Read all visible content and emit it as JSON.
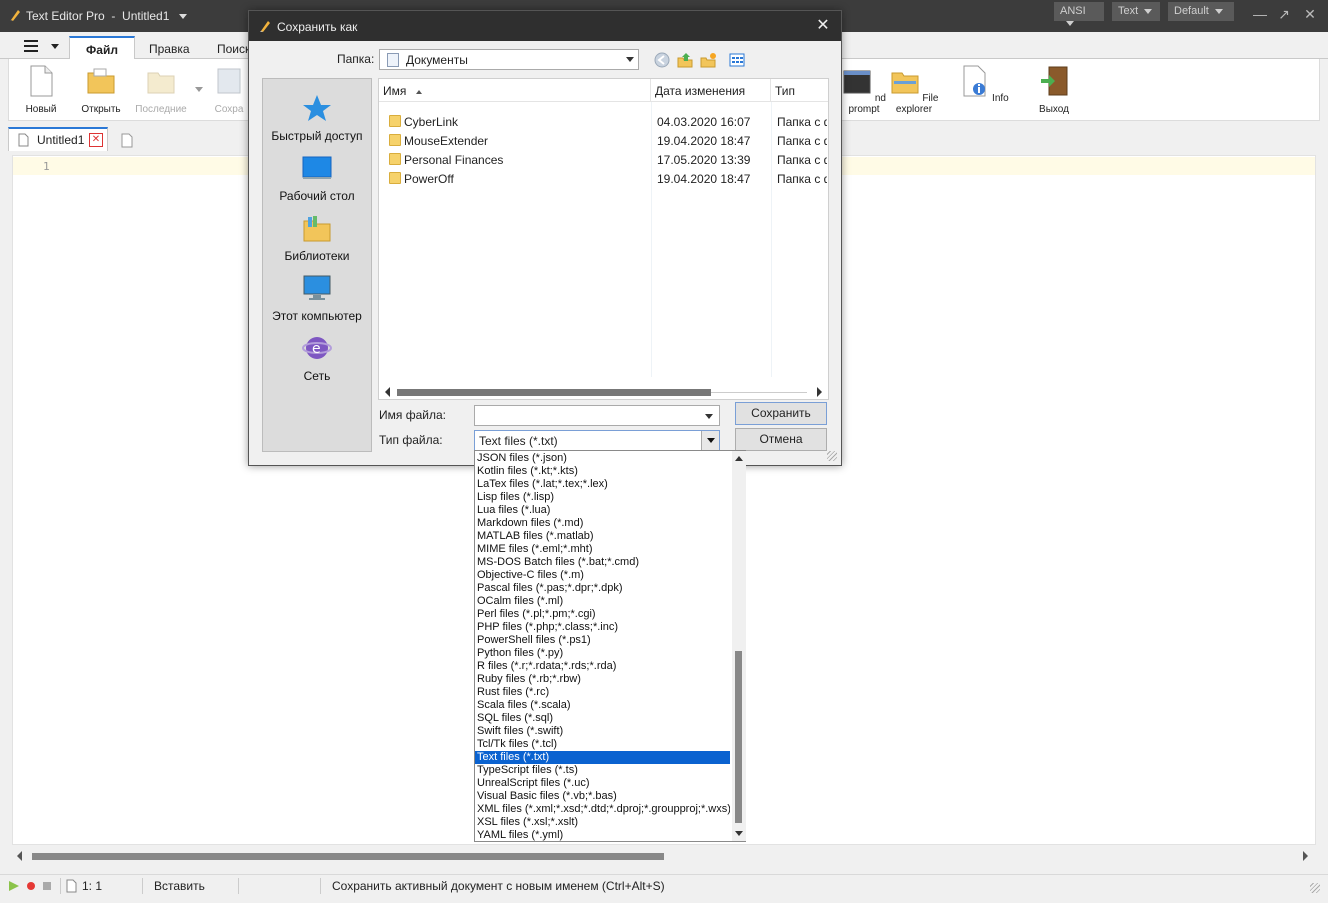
{
  "window": {
    "app_name": "Text Editor Pro",
    "separator": "-",
    "doc_name": "Untitled1",
    "encoding": "ANSI",
    "syntax": "Text",
    "theme": "Default"
  },
  "ribbon_tabs": [
    "Файл",
    "Правка",
    "Поиск"
  ],
  "ribbon": {
    "new": "Новый",
    "open": "Открыть",
    "recent": "Последние",
    "save": "Сохра",
    "cmd_prompt": "nd prompt",
    "file_explorer": "File explorer",
    "info": "Info",
    "exit": "Выход"
  },
  "doc_tab": {
    "label": "Untitled1"
  },
  "editor": {
    "line_number": "1"
  },
  "status": {
    "position": "1: 1",
    "mode": "Вставить",
    "hint": "Сохранить активный документ с новым именем (Ctrl+Alt+S)"
  },
  "dialog": {
    "title": "Сохранить как",
    "folder_label": "Папка:",
    "folder_value": "Документы",
    "places": [
      {
        "label": "Быстрый доступ",
        "icon": "star-icon"
      },
      {
        "label": "Рабочий стол",
        "icon": "desktop-icon"
      },
      {
        "label": "Библиотеки",
        "icon": "libraries-icon"
      },
      {
        "label": "Этот компьютер",
        "icon": "computer-icon"
      },
      {
        "label": "Сеть",
        "icon": "network-icon"
      }
    ],
    "columns": {
      "name": "Имя",
      "date": "Дата изменения",
      "type": "Тип"
    },
    "files": [
      {
        "name": "CyberLink",
        "date": "04.03.2020 16:07",
        "type": "Папка с ф"
      },
      {
        "name": "MouseExtender",
        "date": "19.04.2020 18:47",
        "type": "Папка с ф"
      },
      {
        "name": "Personal Finances",
        "date": "17.05.2020 13:39",
        "type": "Папка с ф"
      },
      {
        "name": "PowerOff",
        "date": "19.04.2020 18:47",
        "type": "Папка с ф"
      }
    ],
    "filename_label": "Имя файла:",
    "filename_value": "",
    "filetype_label": "Тип файла:",
    "filetype_value": "Text files (*.txt)",
    "save_button": "Сохранить",
    "cancel_button": "Отмена"
  },
  "filetype_options": [
    "JSON files (*.json)",
    "Kotlin files (*.kt;*.kts)",
    "LaTex files (*.lat;*.tex;*.lex)",
    "Lisp files (*.lisp)",
    "Lua files (*.lua)",
    "Markdown files (*.md)",
    "MATLAB files (*.matlab)",
    "MIME files (*.eml;*.mht)",
    "MS-DOS Batch files (*.bat;*.cmd)",
    "Objective-C files (*.m)",
    "Pascal files (*.pas;*.dpr;*.dpk)",
    "OCalm files (*.ml)",
    "Perl files (*.pl;*.pm;*.cgi)",
    "PHP files (*.php;*.class;*.inc)",
    "PowerShell files (*.ps1)",
    "Python files (*.py)",
    "R files (*.r;*.rdata;*.rds;*.rda)",
    "Ruby files (*.rb;*.rbw)",
    "Rust files (*.rc)",
    "Scala files (*.scala)",
    "SQL files (*.sql)",
    "Swift files (*.swift)",
    "Tcl/Tk files (*.tcl)",
    "Text files (*.txt)",
    "TypeScript files (*.ts)",
    "UnrealScript files (*.uc)",
    "Visual Basic files (*.vb;*.bas)",
    "XML files (*.xml;*.xsd;*.dtd;*.dproj;*.groupproj;*.wxs)",
    "XSL files (*.xsl;*.xslt)",
    "YAML files (*.yml)"
  ],
  "selected_filetype_index": 23,
  "colors": {
    "accent": "#2a78d6",
    "selection": "#0a62d0",
    "titlebar": "#3c3c3c",
    "dialog_titlebar": "#2f2f2f"
  }
}
